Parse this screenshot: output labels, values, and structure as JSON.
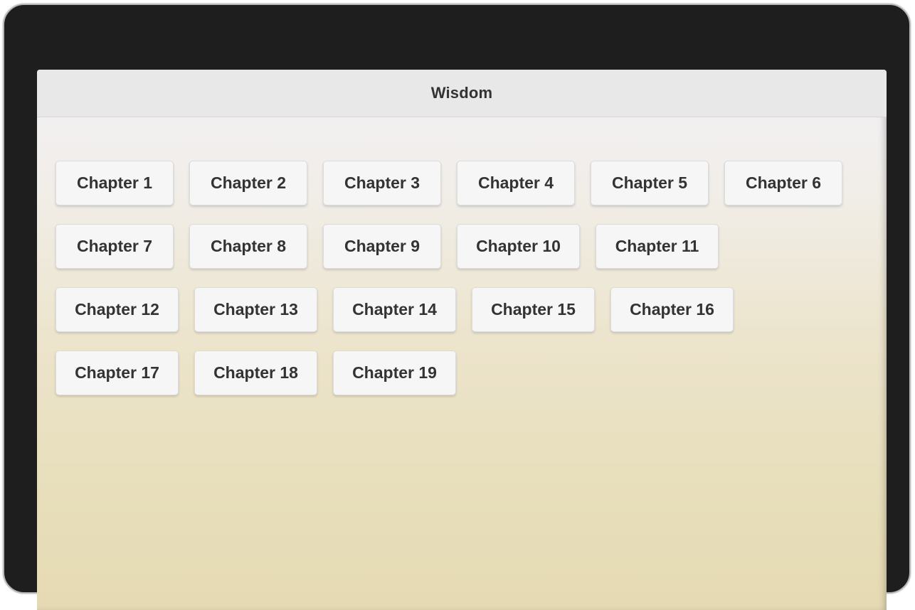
{
  "header": {
    "title": "Wisdom"
  },
  "chapters": {
    "rows": [
      [
        "Chapter 1",
        "Chapter 2",
        "Chapter 3",
        "Chapter 4",
        "Chapter 5",
        "Chapter 6"
      ],
      [
        "Chapter 7",
        "Chapter 8",
        "Chapter 9",
        "Chapter 10",
        "Chapter 11"
      ],
      [
        "Chapter 12",
        "Chapter 13",
        "Chapter 14",
        "Chapter 15",
        "Chapter 16"
      ],
      [
        "Chapter 17",
        "Chapter 18",
        "Chapter 19"
      ]
    ]
  },
  "colors": {
    "bezel": "#1e1e1e",
    "header_bg": "#e8e8e8",
    "button_bg": "#f6f6f6",
    "text": "#333333",
    "gradient_top": "#f2f0f5",
    "gradient_bottom": "#e5dab3"
  }
}
